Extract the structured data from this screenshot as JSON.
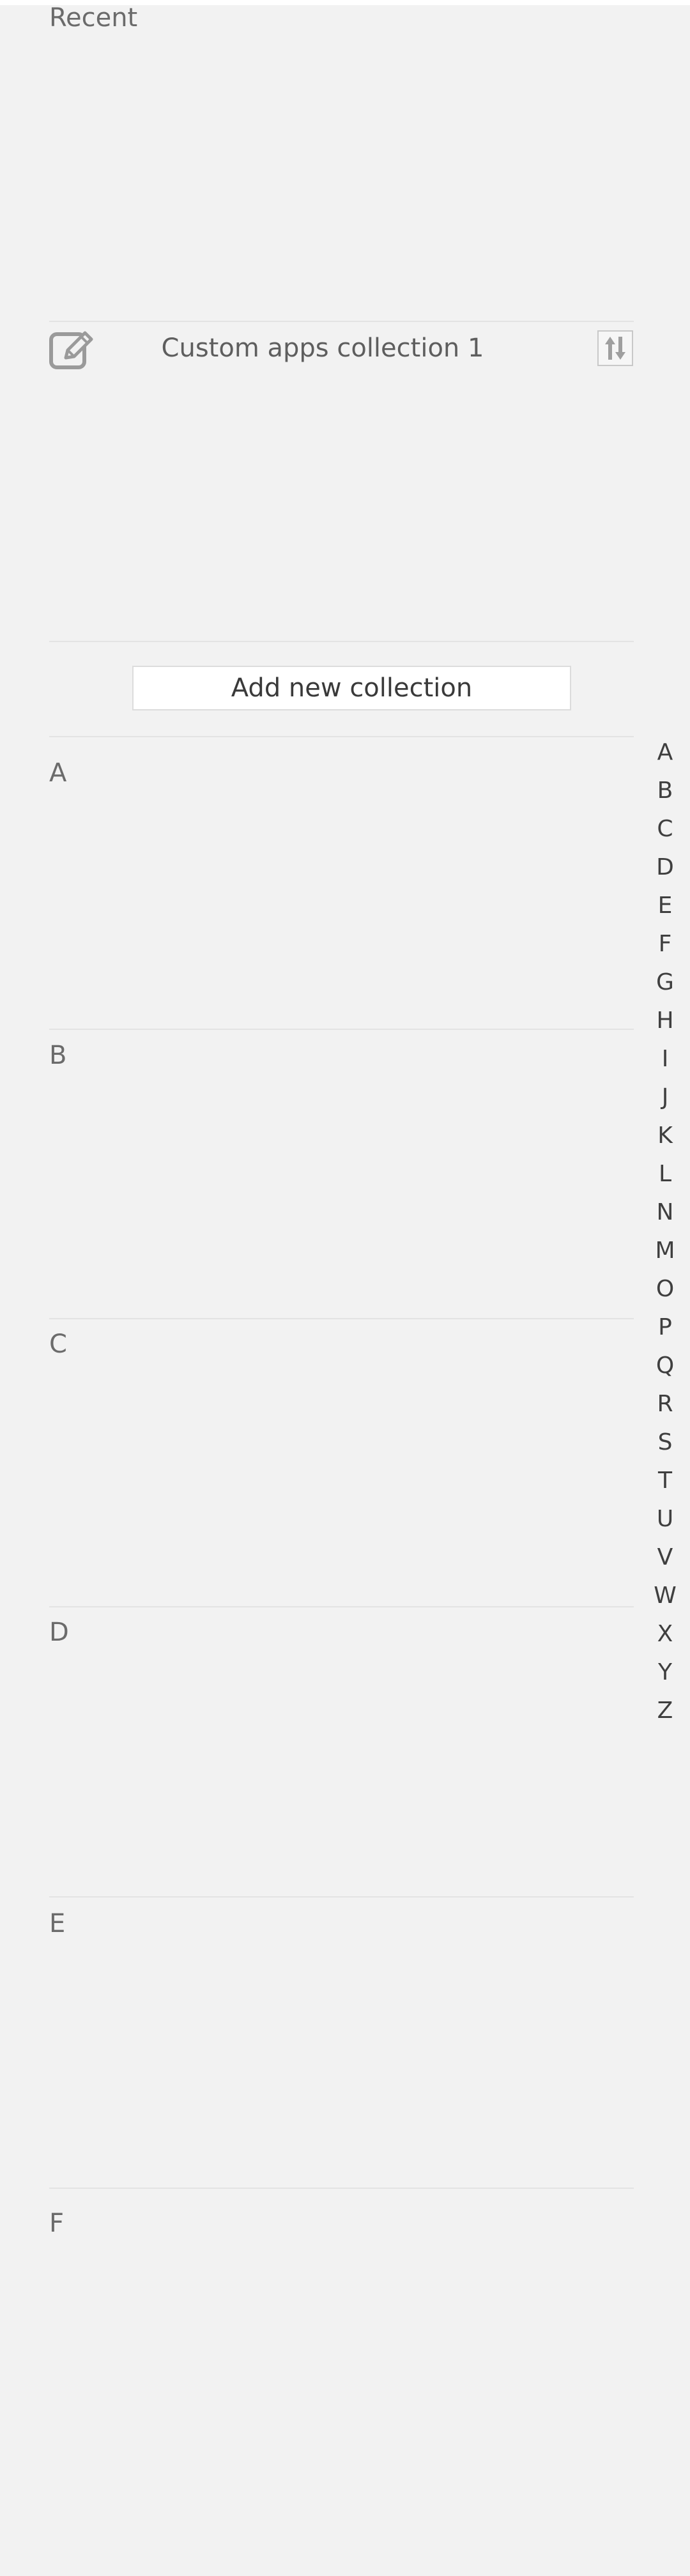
{
  "recent": {
    "label": "Recent"
  },
  "custom_collection": {
    "title": "Custom apps collection 1",
    "edit_icon": "pencil-edit-icon",
    "sort_icon": "sort-arrows-icon"
  },
  "add_collection": {
    "label": "Add new collection"
  },
  "sections": [
    "A",
    "B",
    "C",
    "D",
    "E",
    "F"
  ],
  "alphabet_index": [
    "A",
    "B",
    "C",
    "D",
    "E",
    "F",
    "G",
    "H",
    "I",
    "J",
    "K",
    "L",
    "N",
    "M",
    "O",
    "P",
    "Q",
    "R",
    "S",
    "T",
    "U",
    "V",
    "W",
    "X",
    "Y",
    "Z"
  ],
  "colors": {
    "background": "#f2f2f2",
    "divider": "#e3e3e3",
    "text_muted": "#6b6b6b",
    "button_bg": "#ffffff"
  }
}
